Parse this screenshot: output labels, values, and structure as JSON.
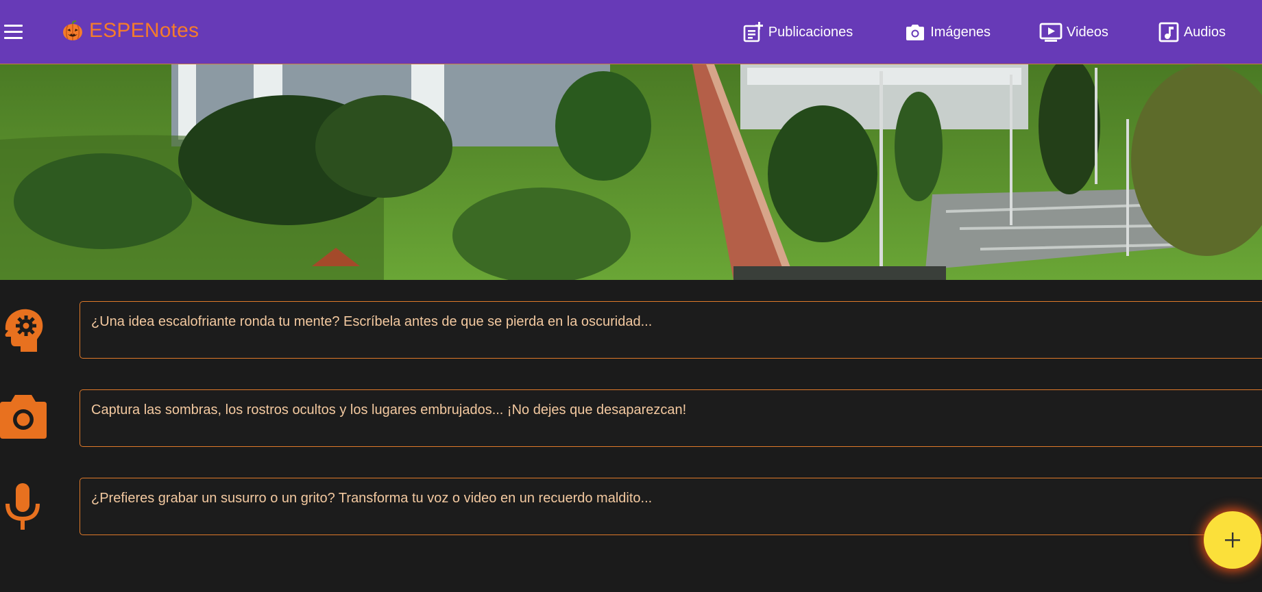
{
  "app": {
    "brand": "ESPENotes",
    "brand_icon": "pumpkin-icon"
  },
  "nav": {
    "items": [
      {
        "label": "Publicaciones",
        "icon": "publicaciones-icon"
      },
      {
        "label": "Imágenes",
        "icon": "camera-icon"
      },
      {
        "label": "Videos",
        "icon": "video-icon"
      },
      {
        "label": "Audios",
        "icon": "music-icon"
      }
    ]
  },
  "prompts": [
    {
      "icon": "head-gear-icon",
      "text": "¿Una idea escalofriante ronda tu mente? Escríbela antes de que se pierda en la oscuridad..."
    },
    {
      "icon": "camera-icon",
      "text": "Captura las sombras, los rostros ocultos y los lugares embrujados... ¡No dejes que desaparezcan!"
    },
    {
      "icon": "microphone-icon",
      "text": "¿Prefieres grabar un susurro o un grito? Transforma tu voz o video en un recuerdo maldito..."
    }
  ],
  "fab": {
    "icon": "plus-icon"
  },
  "colors": {
    "header": "#673ab7",
    "accent": "#f57c2b",
    "background": "#1b1b1b",
    "prompt_text": "#f3c9a0",
    "fab": "#fbe03a"
  }
}
